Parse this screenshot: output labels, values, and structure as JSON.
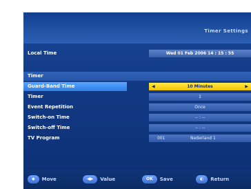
{
  "screen": {
    "title": "Timer Settings"
  },
  "local_time": {
    "label": "Local Time",
    "value": "Wed 01 Feb 2006 14 : 15 : 55"
  },
  "section": {
    "label": "Timer"
  },
  "rows": [
    {
      "label": "Guard-Band Time",
      "value": "10 Minutes"
    },
    {
      "label": "Timer",
      "value": "1"
    },
    {
      "label": "Event Repetition",
      "value": "Once"
    },
    {
      "label": "Switch-on Time",
      "value": "-- : --"
    },
    {
      "label": "Switch-off Time",
      "value": "-- : --"
    },
    {
      "label": "TV Program",
      "channel": "001",
      "channel_name": "Nederland 1"
    }
  ],
  "footer": [
    {
      "key_glyph": "◆",
      "label": "Move"
    },
    {
      "key_glyph": "◀▶",
      "label": "Value"
    },
    {
      "key_glyph": "OK",
      "label": "Save"
    },
    {
      "key_glyph": "◐",
      "label": "Return"
    }
  ],
  "colors": {
    "background": "#123b86",
    "selected_label": "#2f7ee6",
    "selected_value": "#f2c400",
    "value_box": "#2f5aa8"
  }
}
